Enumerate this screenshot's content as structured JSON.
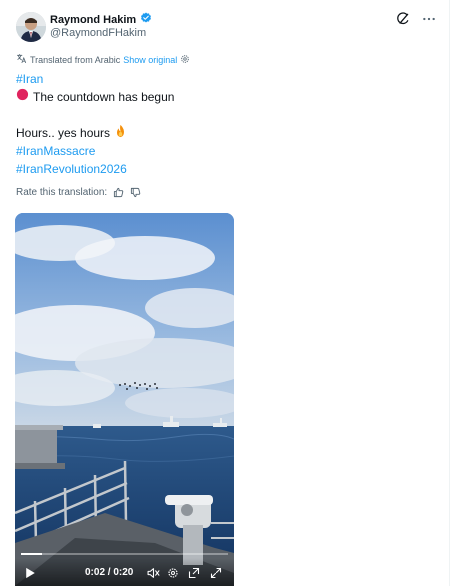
{
  "author": {
    "name": "Raymond Hakim",
    "handle": "@RaymondFHakim",
    "verified": true
  },
  "translation": {
    "label": "Translated from Arabic",
    "show_original": "Show original"
  },
  "tweet_lines": {
    "hashtag_iran": "#Iran",
    "countdown": "The countdown has begun",
    "hours": "Hours.. yes hours",
    "hashtag_massacre": "#IranMassacre",
    "hashtag_revolution": "#IranRevolution2026"
  },
  "rate": {
    "label": "Rate this translation:"
  },
  "video": {
    "time": "0:02 / 0:20",
    "progress": 0.1
  },
  "colors": {
    "accent": "#1d9bf0",
    "text": "#0f1419",
    "muted": "#536471",
    "verified": "#1d9bf0",
    "red_circle": "#e0245e"
  },
  "icons": [
    "verified-badge-icon",
    "grok-icon",
    "more-icon",
    "gear-icon",
    "fire-emoji",
    "red-circle-emoji",
    "thumbs-up-icon",
    "thumbs-down-icon",
    "play-icon",
    "mute-icon",
    "settings-icon",
    "pip-icon",
    "fullscreen-icon"
  ]
}
